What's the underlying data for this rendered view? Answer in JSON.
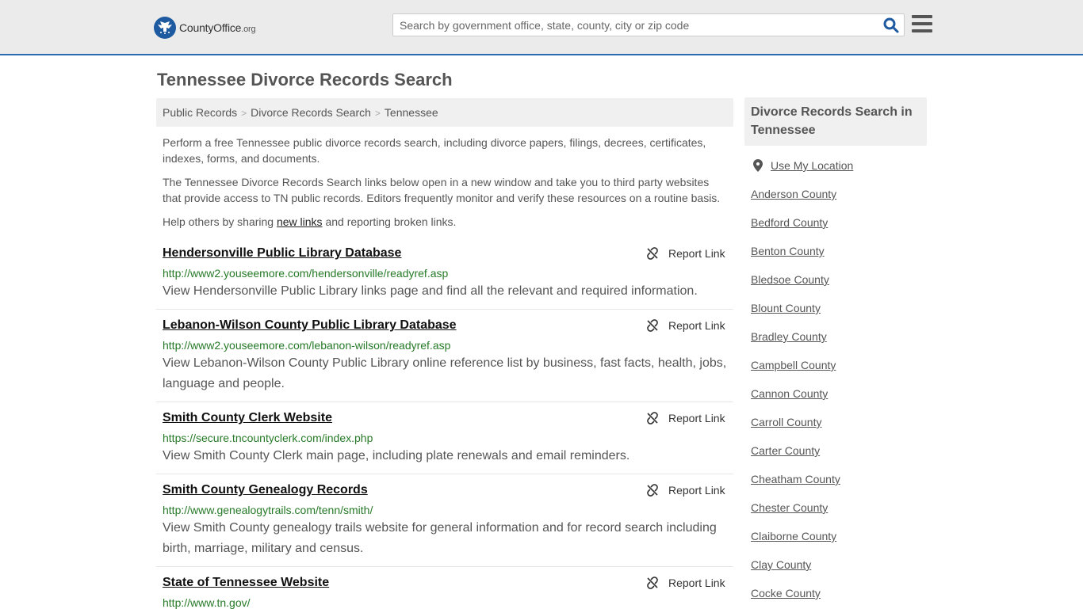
{
  "header": {
    "logo_text": "CountyOffice",
    "logo_suffix": ".org",
    "search_placeholder": "Search by government office, state, county, city or zip code"
  },
  "page_title": "Tennessee Divorce Records Search",
  "breadcrumb": [
    "Public Records",
    "Divorce Records Search",
    "Tennessee"
  ],
  "intro": {
    "p1": "Perform a free Tennessee public divorce records search, including divorce papers, filings, decrees, certificates, indexes, forms, and documents.",
    "p2": "The Tennessee Divorce Records Search links below open in a new window and take you to third party websites that provide access to TN public records. Editors frequently monitor and verify these resources on a routine basis.",
    "p3_before": "Help others by sharing ",
    "p3_link": "new links",
    "p3_after": " and reporting broken links."
  },
  "report_label": "Report Link",
  "results": [
    {
      "title": "Hendersonville Public Library Database",
      "url": "http://www2.youseemore.com/hendersonville/readyref.asp",
      "desc": "View Hendersonville Public Library links page and find all the relevant and required information."
    },
    {
      "title": "Lebanon-Wilson County Public Library Database",
      "url": "http://www2.youseemore.com/lebanon-wilson/readyref.asp",
      "desc": "View Lebanon-Wilson County Public Library online reference list by business, fast facts, health, jobs, language and people."
    },
    {
      "title": "Smith County Clerk Website",
      "url": "https://secure.tncountyclerk.com/index.php",
      "desc": "View Smith County Clerk main page, including plate renewals and email reminders."
    },
    {
      "title": "Smith County Genealogy Records",
      "url": "http://www.genealogytrails.com/tenn/smith/",
      "desc": "View Smith County genealogy trails website for general information and for record search including birth, marriage, military and census."
    },
    {
      "title": "State of Tennessee Website",
      "url": "http://www.tn.gov/",
      "desc": ""
    }
  ],
  "sidebar": {
    "heading": "Divorce Records Search in Tennessee",
    "use_location": "Use My Location",
    "counties": [
      "Anderson County",
      "Bedford County",
      "Benton County",
      "Bledsoe County",
      "Blount County",
      "Bradley County",
      "Campbell County",
      "Cannon County",
      "Carroll County",
      "Carter County",
      "Cheatham County",
      "Chester County",
      "Claiborne County",
      "Clay County",
      "Cocke County"
    ]
  }
}
